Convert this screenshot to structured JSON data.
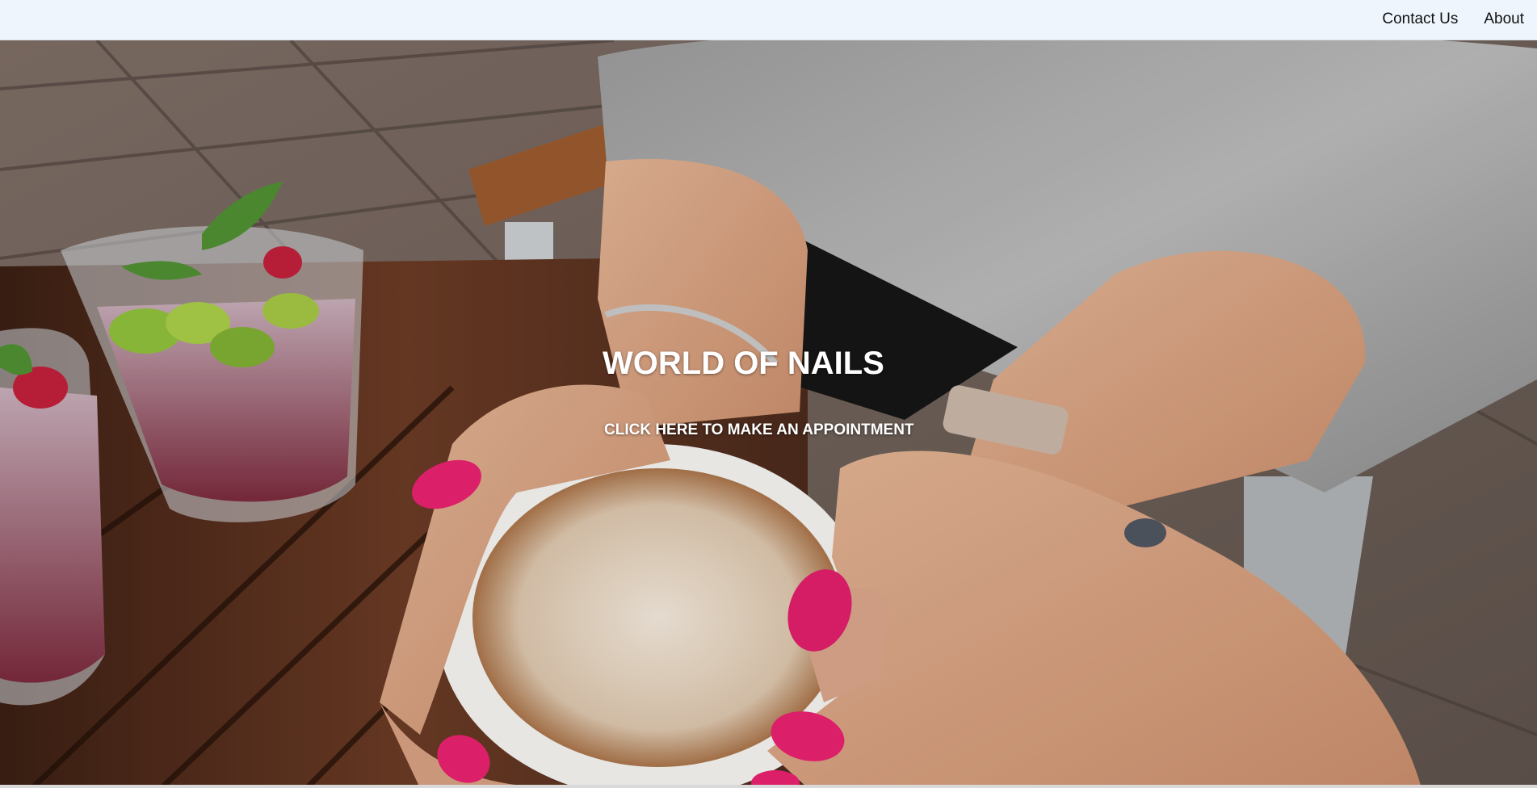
{
  "nav": {
    "links": [
      {
        "label": "Contact Us"
      },
      {
        "label": "About"
      }
    ]
  },
  "hero": {
    "title": "WORLD OF NAILS",
    "cta_label": "CLICK HERE TO MAKE AN APPOINTMENT",
    "image_description_icon": "photo-coffee-cup-pink-nails"
  },
  "colors": {
    "navbar_bg": "#eef5fd",
    "nail_pink": "#e8216f",
    "hero_text": "#ffffff"
  }
}
